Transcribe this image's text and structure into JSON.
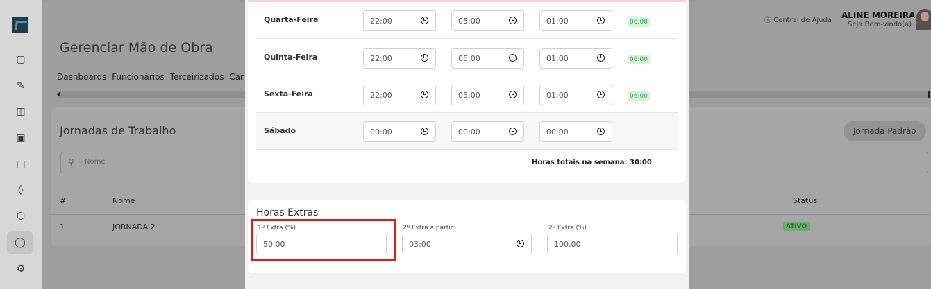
{
  "app": {
    "title": "Gerenciar Mão de Obra",
    "nav": [
      "Dashboards",
      "Funcionários",
      "Terceirizados",
      "Car"
    ],
    "help_label": "Central de Ajuda",
    "user": {
      "name": "ALINE MOREIRA",
      "greeting": "Seja Bem-vindo(a)"
    }
  },
  "background_card": {
    "title": "Jornadas de Trabalho",
    "default_button": "Jornada Padrão",
    "search_placeholder": "Nome",
    "columns": {
      "index": "#",
      "name": "Nome",
      "status": "Status"
    },
    "rows": [
      {
        "index": "1",
        "name": "JORNADA 2",
        "status": "ATIVO"
      }
    ]
  },
  "schedule": {
    "rows": [
      {
        "day": "Quarta-Feira",
        "start": "22:00",
        "end": "05:00",
        "break": "01:00",
        "total": "06:00"
      },
      {
        "day": "Quinta-Feira",
        "start": "22:00",
        "end": "05:00",
        "break": "01:00",
        "total": "06:00"
      },
      {
        "day": "Sexta-Feira",
        "start": "22:00",
        "end": "05:00",
        "break": "01:00",
        "total": "06:00"
      },
      {
        "day": "Sábado",
        "start": "00:00",
        "end": "00:00",
        "break": "00:00",
        "total": ""
      }
    ],
    "weekly_total_label": "Horas totais na semana:",
    "weekly_total_value": "30:00"
  },
  "overtime": {
    "title": "Horas Extras",
    "first_extra_label": "1º Extra (%)",
    "first_extra_value": "50,00",
    "second_from_label": "2º Extra a partir:",
    "second_from_value": "03:00",
    "second_extra_label": "2º Extra (%)",
    "second_extra_value": "100,00"
  },
  "colors": {
    "highlight": "#e01b1b",
    "total_badge_bg": "#d7f5dc",
    "total_badge_text": "#2f9e48"
  },
  "icons": {
    "sidebar": [
      "monitor-icon",
      "pencil-icon",
      "kanban-icon",
      "bag-icon",
      "file-icon",
      "layers-icon",
      "box-icon",
      "user-icon",
      "wrench-icon"
    ]
  }
}
